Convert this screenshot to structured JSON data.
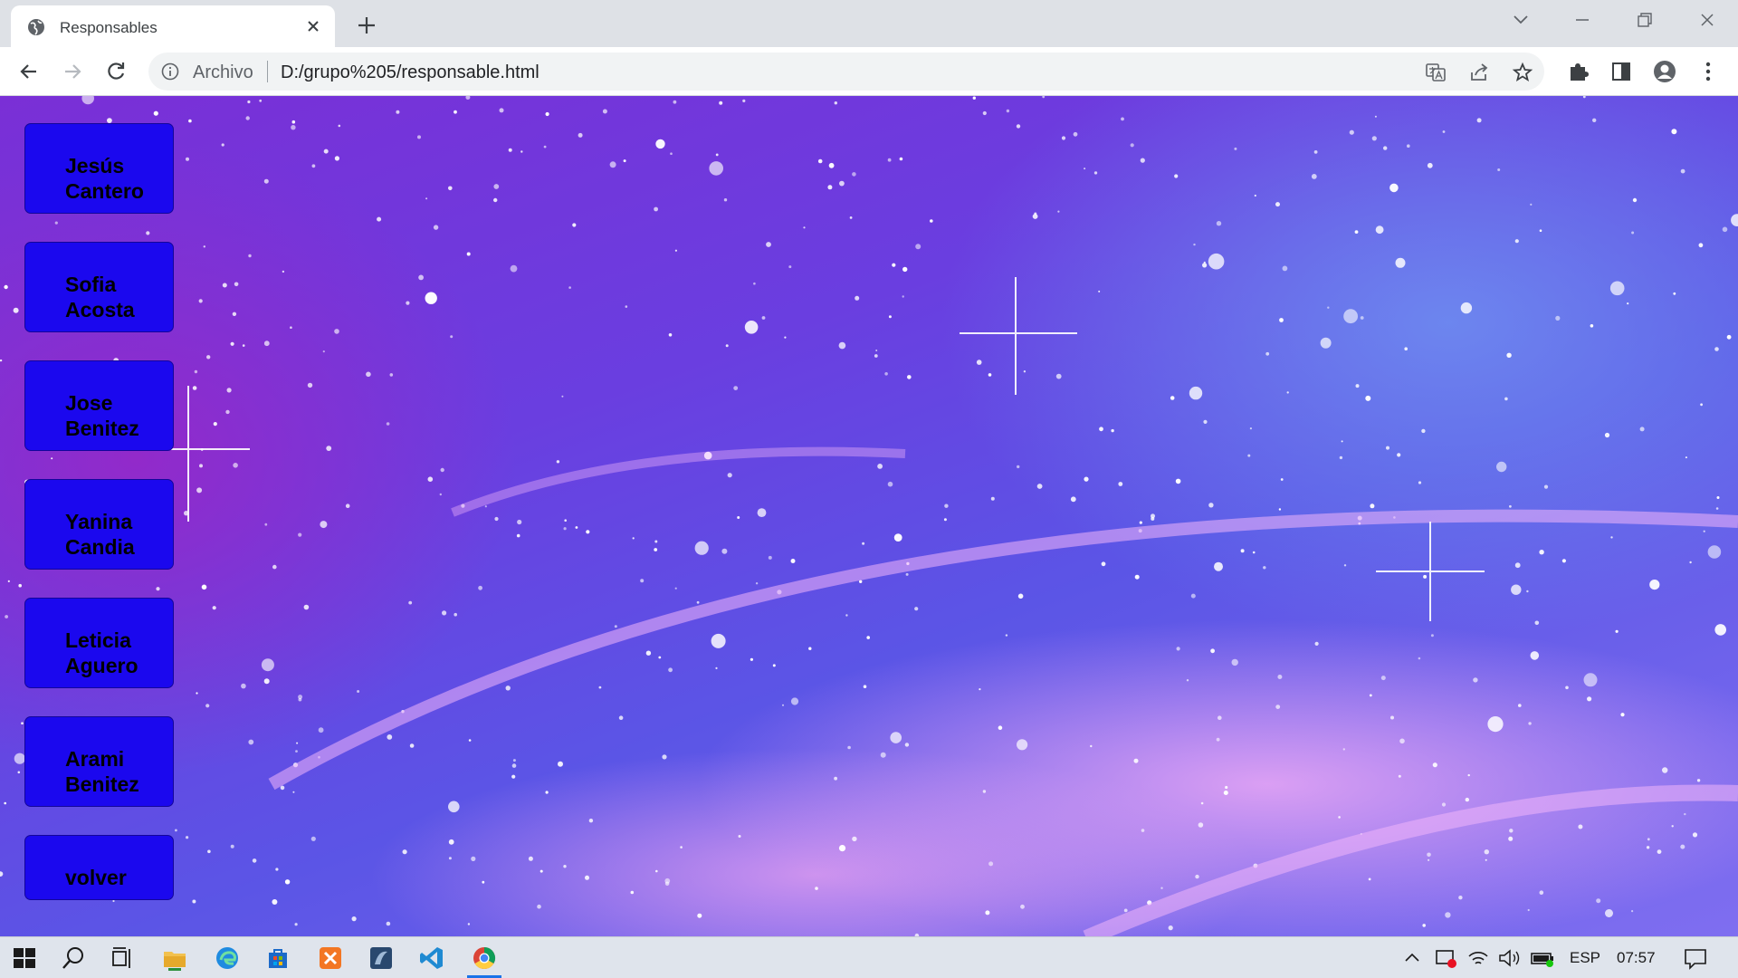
{
  "browser": {
    "tab_title": "Responsables",
    "omnibox": {
      "scheme_label": "Archivo",
      "url": "D:/grupo%205/responsable.html"
    }
  },
  "page": {
    "buttons": [
      {
        "label": "Jesús Cantero"
      },
      {
        "label": "Sofia Acosta"
      },
      {
        "label": "Jose Benitez"
      },
      {
        "label": "Yanina Candia"
      },
      {
        "label": "Leticia Aguero"
      },
      {
        "label": "Arami Benitez"
      },
      {
        "label": "volver"
      }
    ],
    "colors": {
      "button_bg": "#1b08ee",
      "button_text": "#000000"
    }
  },
  "taskbar": {
    "apps": [
      "start-icon",
      "search-icon",
      "task-view-icon",
      "file-explorer-icon",
      "edge-icon",
      "store-icon",
      "xampp-icon",
      "sql-icon",
      "vscode-icon",
      "chrome-icon"
    ],
    "language": "ESP",
    "time": "07:57"
  }
}
